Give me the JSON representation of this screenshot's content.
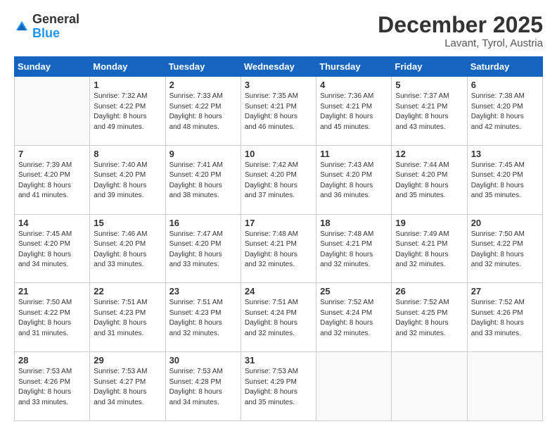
{
  "logo": {
    "general": "General",
    "blue": "Blue"
  },
  "header": {
    "month": "December 2025",
    "location": "Lavant, Tyrol, Austria"
  },
  "weekdays": [
    "Sunday",
    "Monday",
    "Tuesday",
    "Wednesday",
    "Thursday",
    "Friday",
    "Saturday"
  ],
  "weeks": [
    [
      {
        "day": "",
        "sunrise": "",
        "sunset": "",
        "daylight": ""
      },
      {
        "day": "1",
        "sunrise": "7:32 AM",
        "sunset": "4:22 PM",
        "daylight": "8 hours and 49 minutes."
      },
      {
        "day": "2",
        "sunrise": "7:33 AM",
        "sunset": "4:22 PM",
        "daylight": "8 hours and 48 minutes."
      },
      {
        "day": "3",
        "sunrise": "7:35 AM",
        "sunset": "4:21 PM",
        "daylight": "8 hours and 46 minutes."
      },
      {
        "day": "4",
        "sunrise": "7:36 AM",
        "sunset": "4:21 PM",
        "daylight": "8 hours and 45 minutes."
      },
      {
        "day": "5",
        "sunrise": "7:37 AM",
        "sunset": "4:21 PM",
        "daylight": "8 hours and 43 minutes."
      },
      {
        "day": "6",
        "sunrise": "7:38 AM",
        "sunset": "4:20 PM",
        "daylight": "8 hours and 42 minutes."
      }
    ],
    [
      {
        "day": "7",
        "sunrise": "7:39 AM",
        "sunset": "4:20 PM",
        "daylight": "8 hours and 41 minutes."
      },
      {
        "day": "8",
        "sunrise": "7:40 AM",
        "sunset": "4:20 PM",
        "daylight": "8 hours and 39 minutes."
      },
      {
        "day": "9",
        "sunrise": "7:41 AM",
        "sunset": "4:20 PM",
        "daylight": "8 hours and 38 minutes."
      },
      {
        "day": "10",
        "sunrise": "7:42 AM",
        "sunset": "4:20 PM",
        "daylight": "8 hours and 37 minutes."
      },
      {
        "day": "11",
        "sunrise": "7:43 AM",
        "sunset": "4:20 PM",
        "daylight": "8 hours and 36 minutes."
      },
      {
        "day": "12",
        "sunrise": "7:44 AM",
        "sunset": "4:20 PM",
        "daylight": "8 hours and 35 minutes."
      },
      {
        "day": "13",
        "sunrise": "7:45 AM",
        "sunset": "4:20 PM",
        "daylight": "8 hours and 35 minutes."
      }
    ],
    [
      {
        "day": "14",
        "sunrise": "7:45 AM",
        "sunset": "4:20 PM",
        "daylight": "8 hours and 34 minutes."
      },
      {
        "day": "15",
        "sunrise": "7:46 AM",
        "sunset": "4:20 PM",
        "daylight": "8 hours and 33 minutes."
      },
      {
        "day": "16",
        "sunrise": "7:47 AM",
        "sunset": "4:20 PM",
        "daylight": "8 hours and 33 minutes."
      },
      {
        "day": "17",
        "sunrise": "7:48 AM",
        "sunset": "4:21 PM",
        "daylight": "8 hours and 32 minutes."
      },
      {
        "day": "18",
        "sunrise": "7:48 AM",
        "sunset": "4:21 PM",
        "daylight": "8 hours and 32 minutes."
      },
      {
        "day": "19",
        "sunrise": "7:49 AM",
        "sunset": "4:21 PM",
        "daylight": "8 hours and 32 minutes."
      },
      {
        "day": "20",
        "sunrise": "7:50 AM",
        "sunset": "4:22 PM",
        "daylight": "8 hours and 32 minutes."
      }
    ],
    [
      {
        "day": "21",
        "sunrise": "7:50 AM",
        "sunset": "4:22 PM",
        "daylight": "8 hours and 31 minutes."
      },
      {
        "day": "22",
        "sunrise": "7:51 AM",
        "sunset": "4:23 PM",
        "daylight": "8 hours and 31 minutes."
      },
      {
        "day": "23",
        "sunrise": "7:51 AM",
        "sunset": "4:23 PM",
        "daylight": "8 hours and 32 minutes."
      },
      {
        "day": "24",
        "sunrise": "7:51 AM",
        "sunset": "4:24 PM",
        "daylight": "8 hours and 32 minutes."
      },
      {
        "day": "25",
        "sunrise": "7:52 AM",
        "sunset": "4:24 PM",
        "daylight": "8 hours and 32 minutes."
      },
      {
        "day": "26",
        "sunrise": "7:52 AM",
        "sunset": "4:25 PM",
        "daylight": "8 hours and 32 minutes."
      },
      {
        "day": "27",
        "sunrise": "7:52 AM",
        "sunset": "4:26 PM",
        "daylight": "8 hours and 33 minutes."
      }
    ],
    [
      {
        "day": "28",
        "sunrise": "7:53 AM",
        "sunset": "4:26 PM",
        "daylight": "8 hours and 33 minutes."
      },
      {
        "day": "29",
        "sunrise": "7:53 AM",
        "sunset": "4:27 PM",
        "daylight": "8 hours and 34 minutes."
      },
      {
        "day": "30",
        "sunrise": "7:53 AM",
        "sunset": "4:28 PM",
        "daylight": "8 hours and 34 minutes."
      },
      {
        "day": "31",
        "sunrise": "7:53 AM",
        "sunset": "4:29 PM",
        "daylight": "8 hours and 35 minutes."
      },
      {
        "day": "",
        "sunrise": "",
        "sunset": "",
        "daylight": ""
      },
      {
        "day": "",
        "sunrise": "",
        "sunset": "",
        "daylight": ""
      },
      {
        "day": "",
        "sunrise": "",
        "sunset": "",
        "daylight": ""
      }
    ]
  ]
}
